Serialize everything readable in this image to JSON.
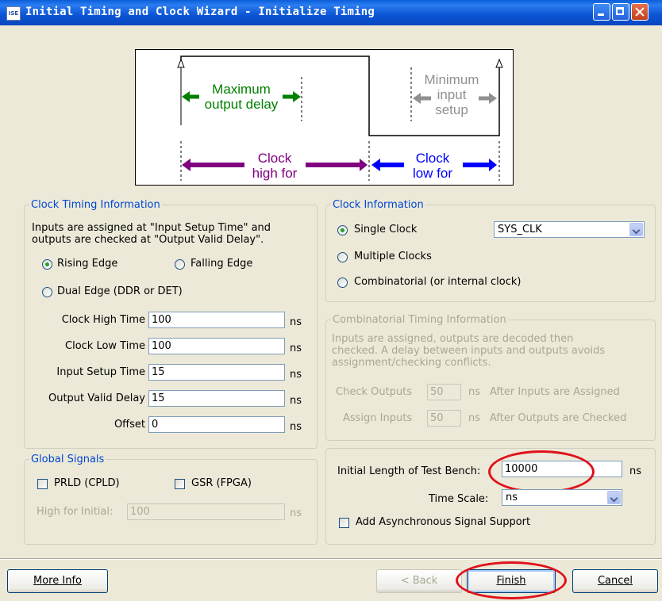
{
  "app": {
    "icon_text": "ISE",
    "title": "Initial Timing and Clock Wizard - Initialize Timing"
  },
  "diagram": {
    "max_output_delay": [
      "Maximum",
      "output delay"
    ],
    "min_input_setup": [
      "Minimum",
      "input",
      "setup"
    ],
    "clock_high_for": [
      "Clock",
      "high for"
    ],
    "clock_low_for": [
      "Clock",
      "low for"
    ],
    "colors": {
      "max_output": "#008000",
      "min_input": "#909090",
      "clock_high": "#800080",
      "clock_low": "#0000ff"
    }
  },
  "clock_timing": {
    "legend": "Clock Timing Information",
    "desc_lines": [
      "Inputs are assigned at \"Input Setup Time\" and",
      "outputs are checked at \"Output Valid Delay\"."
    ],
    "rising_edge": "Rising Edge",
    "falling_edge": "Falling Edge",
    "dual_edge": "Dual Edge (DDR or DET)",
    "fields": [
      {
        "label": "Clock High Time",
        "value": "100",
        "unit": "ns"
      },
      {
        "label": "Clock Low Time",
        "value": "100",
        "unit": "ns"
      },
      {
        "label": "Input Setup Time",
        "value": "15",
        "unit": "ns"
      },
      {
        "label": "Output Valid Delay",
        "value": "15",
        "unit": "ns"
      },
      {
        "label": "Offset",
        "value": "0",
        "unit": "ns"
      }
    ]
  },
  "clock_info": {
    "legend": "Clock Information",
    "single_clock": "Single Clock",
    "clock_select": "SYS_CLK",
    "multiple_clocks": "Multiple Clocks",
    "combinatorial": "Combinatorial (or internal clock)"
  },
  "comb_timing": {
    "legend": "Combinatorial Timing Information",
    "desc_lines": [
      "Inputs are assigned, outputs are decoded then",
      "checked.  A delay between inputs and outputs avoids",
      "assignment/checking conflicts."
    ],
    "check_outputs": {
      "label": "Check Outputs",
      "value": "50",
      "unit": "ns",
      "suffix": "After Inputs are Assigned"
    },
    "assign_inputs": {
      "label": "Assign Inputs",
      "value": "50",
      "unit": "ns",
      "suffix": "After Outputs are Checked"
    }
  },
  "global_signals": {
    "legend": "Global Signals",
    "prld": "PRLD (CPLD)",
    "gsr": "GSR (FPGA)",
    "high_for_label": "High for Initial:",
    "high_for_value": "100",
    "unit": "ns"
  },
  "test_bench": {
    "length_label": "Initial Length of Test Bench:",
    "length_value": "10000",
    "length_unit": "ns",
    "time_scale_label": "Time Scale:",
    "time_scale_value": "ns",
    "async_label": "Add Asynchronous Signal Support"
  },
  "buttons": {
    "more_info": "More Info",
    "back": "< Back",
    "finish": "Finish",
    "cancel": "Cancel"
  },
  "highlight_color": "#e0121b"
}
